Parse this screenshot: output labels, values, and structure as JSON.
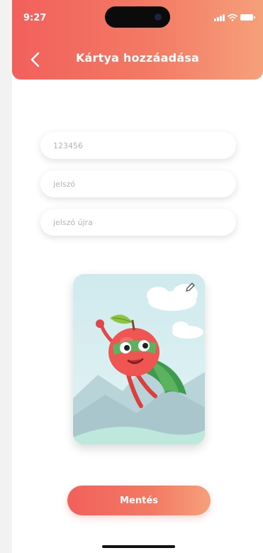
{
  "status_bar": {
    "time": "9:27",
    "icons": [
      "signal-icon",
      "wifi-icon",
      "battery-icon"
    ]
  },
  "header": {
    "title": "Kártya hozzáadása",
    "back_icon": "chevron-left-icon"
  },
  "form": {
    "card_number": {
      "value": "",
      "placeholder": "123456"
    },
    "password": {
      "value": "",
      "placeholder": "jelszó"
    },
    "password_repeat": {
      "value": "",
      "placeholder": "jelszó újra"
    }
  },
  "card_image": {
    "illustration": "superhero-apple-illustration",
    "edit_icon": "pencil-icon"
  },
  "actions": {
    "save_label": "Mentés"
  },
  "colors": {
    "accent_start": "#f2605c",
    "accent_end": "#f6a07a",
    "card_sky": "#d6eef0",
    "apple_red": "#ee5553",
    "mask_green": "#5bb35f"
  }
}
